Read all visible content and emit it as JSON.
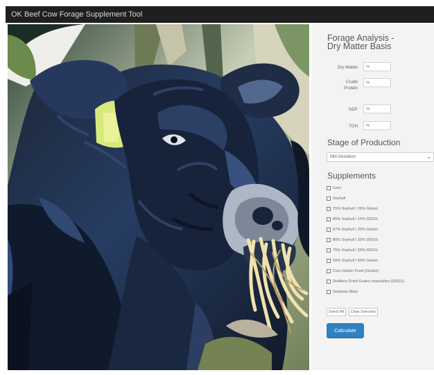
{
  "app": {
    "title": "OK Beef Cow Forage Supplement Tool"
  },
  "forage_analysis": {
    "title_line_1": "Forage Analysis -",
    "title_line_2": "Dry Matter Basis",
    "fields": [
      {
        "label": "Dry Matter",
        "placeholder": "%"
      },
      {
        "label_line_1": "Crude",
        "label_line_2": "Protein",
        "placeholder": "%"
      },
      {
        "label": "NDF",
        "placeholder": "%"
      },
      {
        "label": "TDN",
        "placeholder": "%"
      }
    ]
  },
  "stage_of_production": {
    "title": "Stage of Production",
    "selected": "Mid Gestation",
    "caret": "⌄"
  },
  "supplements": {
    "title": "Supplements",
    "items": [
      "Corn",
      "Soyhull",
      "75% Soyhull / 25% Gluten",
      "85% Soyhull / 15% DDGS",
      "67% Soyhull / 33% Gluten",
      "80% Soyhull / 20% DDGS",
      "75% Soyhull / 25% DDGS",
      "50% Soyhull / 50% Gluten",
      "Corn Gluten Feed (Gluten)",
      "Distillers Dried Grains w/solubles (DDGS)",
      "Soybean Meal"
    ],
    "buttons": {
      "select_all": "Select All",
      "clear_selection": "Clear Selection",
      "calculate": "Calculate"
    }
  },
  "colors": {
    "title_bar": "#1f1f1f",
    "panel": "#f3f3f3",
    "accent": "#2f81bf"
  },
  "icons": {
    "select_caret": "chevron-down-icon",
    "checkbox": "checkbox-icon"
  }
}
